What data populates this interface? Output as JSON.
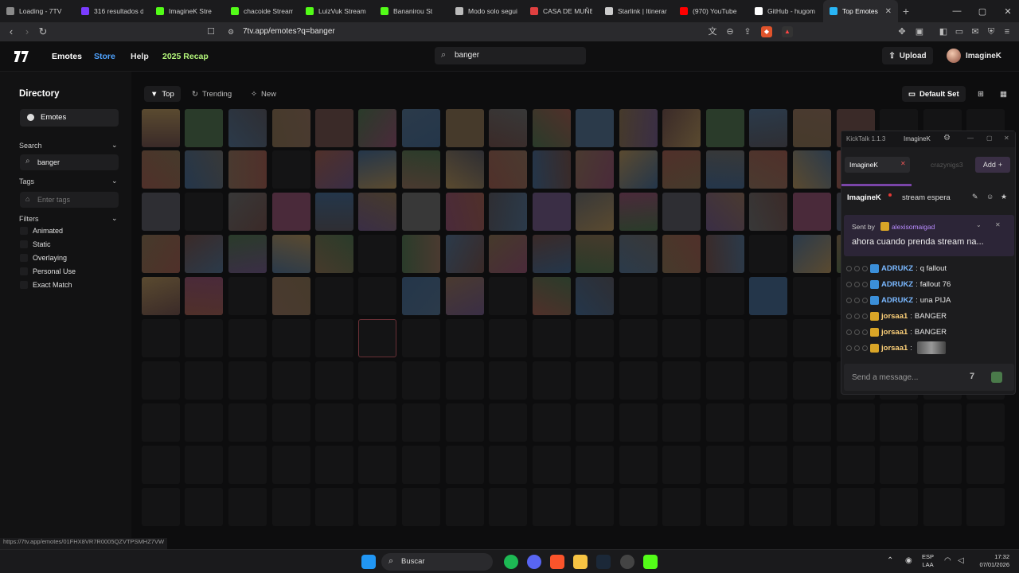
{
  "browser": {
    "tabs": [
      {
        "title": "Loading - 7TV",
        "color": "#8a8a8a"
      },
      {
        "title": "316 resultados de",
        "color": "#7a3cff"
      },
      {
        "title": "ImagineK Stre",
        "color": "#53fc18"
      },
      {
        "title": "chacoide Stream",
        "color": "#53fc18"
      },
      {
        "title": "LuizVuk Stream",
        "color": "#53fc18"
      },
      {
        "title": "Bananirou St",
        "color": "#53fc18"
      },
      {
        "title": "Modo solo segui",
        "color": "#bbbbbb"
      },
      {
        "title": "CASA DE MUÑEC",
        "color": "#e04040"
      },
      {
        "title": "Starlink | Itinerari",
        "color": "#cccccc"
      },
      {
        "title": "(970) YouTube",
        "color": "#ff0000"
      },
      {
        "title": "GitHub - hugom",
        "color": "#ffffff"
      },
      {
        "title": "Top Emotes",
        "color": "#29b6f6",
        "active": true
      }
    ],
    "url": "7tv.app/emotes?q=banger",
    "status_url": "https://7tv.app/emotes/01FHX8VR7R0005QZVTPSMHZ7VW"
  },
  "header": {
    "nav": [
      "Emotes",
      "Store",
      "Help",
      "2025 Recap"
    ],
    "search_value": "banger",
    "upload_label": "Upload",
    "username": "ImagineK"
  },
  "sidebar": {
    "title": "Directory",
    "emotes_label": "Emotes",
    "search_label": "Search",
    "search_value": "banger",
    "tags_label": "Tags",
    "tags_placeholder": "Enter tags",
    "filters_label": "Filters",
    "filters": [
      "Animated",
      "Static",
      "Overlaying",
      "Personal Use",
      "Exact Match"
    ]
  },
  "content": {
    "tabs": [
      "Top",
      "Trending",
      "New"
    ],
    "default_set_label": "Default Set"
  },
  "chat": {
    "title": "KickTalk 1.1.3",
    "user": "ImagineK",
    "channel_tabs": [
      "ImagineK",
      "crazynigs3"
    ],
    "add_label": "Add",
    "stream_title": "stream espera",
    "pinned_sender_label": "Sent by",
    "pinned_sender": "alexisomaigad",
    "pinned_text": "ahora cuando prenda stream na...",
    "messages": [
      {
        "user": "ADRUKZ",
        "text": "q fallout"
      },
      {
        "user": "ADRUKZ",
        "text": "fallout 76"
      },
      {
        "user": "ADRUKZ",
        "text": "una PIJA"
      },
      {
        "user": "jorsaa1",
        "text": "BANGER"
      },
      {
        "user": "jorsaa1",
        "text": "BANGER"
      },
      {
        "user": "jorsaa1",
        "text": ""
      }
    ],
    "input_placeholder": "Send a message...",
    "colors": {
      "adrukz": "#7ab8ff",
      "jorsaa1": "#ffd27a"
    }
  },
  "taskbar": {
    "search_label": "Buscar",
    "lang": "ESP",
    "lang_sub": "LAA",
    "time": "17:32",
    "date": "07/01/2026"
  }
}
